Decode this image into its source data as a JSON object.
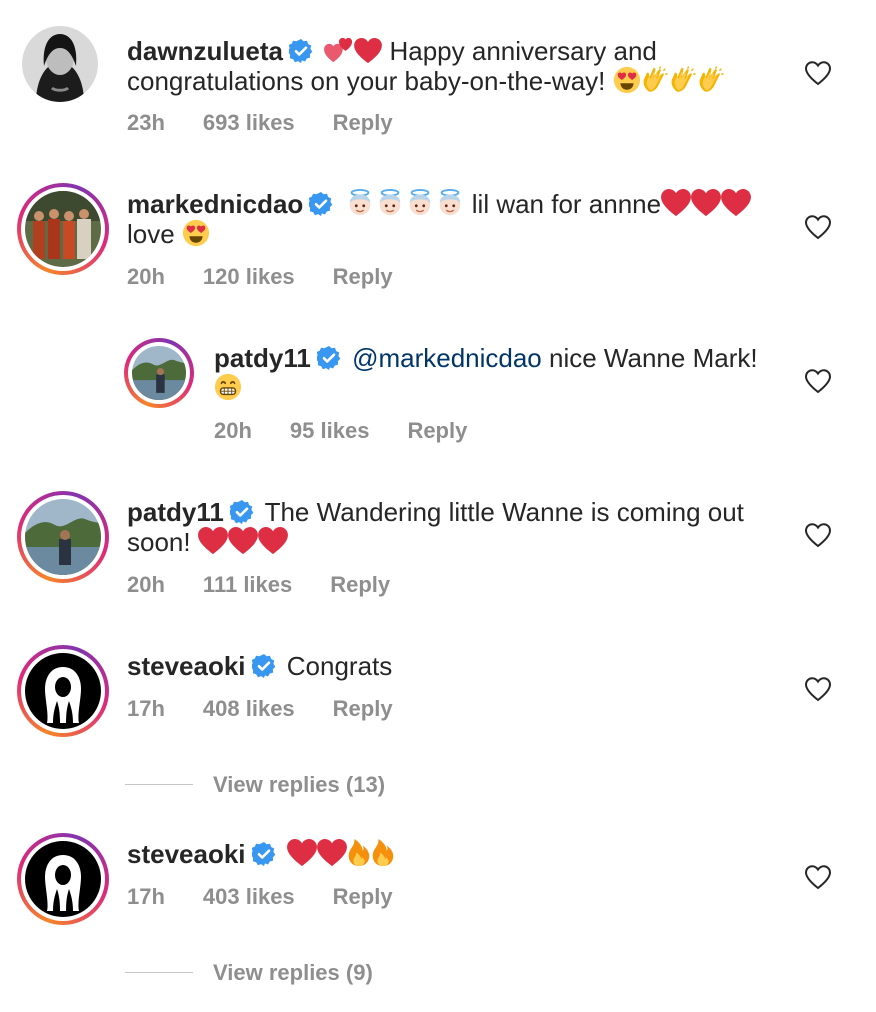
{
  "comments": [
    {
      "username": "dawnzulueta",
      "text_line1": "Happy anniversary and",
      "text_line2": "congratulations on your baby-on-the-way!",
      "time": "23h",
      "likes": "693 likes",
      "reply": "Reply",
      "emojis_before": [
        "two-hearts",
        "red-heart"
      ],
      "emojis_after": [
        "heart-eyes",
        "clap",
        "clap",
        "clap"
      ]
    },
    {
      "username": "markednicdao",
      "text_line1": "lil wan for annne",
      "text_line2": "love",
      "time": "20h",
      "likes": "120 likes",
      "reply": "Reply",
      "emojis_before": [
        "baby-angel",
        "baby-angel",
        "baby-angel",
        "baby-angel"
      ],
      "emojis_after": [
        "red-heart",
        "red-heart",
        "red-heart"
      ]
    },
    {
      "username": "patdy11",
      "mention": "@markednicdao",
      "text_line1": "nice Wanne Mark!",
      "time": "20h",
      "likes": "95 likes",
      "reply": "Reply",
      "emojis_after": [
        "grin"
      ]
    },
    {
      "username": "patdy11",
      "text_line1": "The  Wandering little Wanne is coming out",
      "text_line2": "soon!",
      "time": "20h",
      "likes": "111 likes",
      "reply": "Reply",
      "emojis_after": [
        "red-heart",
        "red-heart",
        "red-heart"
      ]
    },
    {
      "username": "steveaoki",
      "text_line1": "Congrats",
      "time": "17h",
      "likes": "408 likes",
      "reply": "Reply",
      "view_replies": "View replies (13)"
    },
    {
      "username": "steveaoki",
      "text_line1": "",
      "time": "17h",
      "likes": "403 likes",
      "reply": "Reply",
      "emojis_after": [
        "red-heart",
        "red-heart",
        "fire",
        "fire"
      ],
      "view_replies": "View replies (9)"
    }
  ],
  "colors": {
    "text": "#262626",
    "meta": "#8e8e8e",
    "verified": "#3897f0",
    "mention": "#003569",
    "heart": "#ed4956"
  }
}
